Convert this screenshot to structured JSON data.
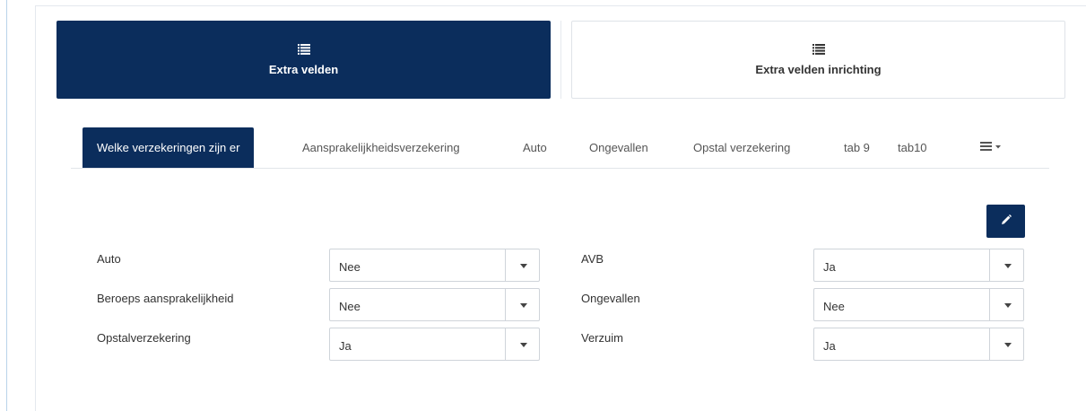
{
  "top_buttons": {
    "primary_label": "Extra velden",
    "primary_icon": "list-icon",
    "secondary_label": "Extra velden inrichting",
    "secondary_icon": "list-icon"
  },
  "tabs": [
    {
      "label": "Welke verzekeringen zijn er",
      "active": true
    },
    {
      "label": "Aansprakelijkheidsverzekering",
      "active": false
    },
    {
      "label": "Auto",
      "active": false
    },
    {
      "label": "Ongevallen",
      "active": false
    },
    {
      "label": "Opstal verzekering",
      "active": false
    },
    {
      "label": "tab 9",
      "active": false
    },
    {
      "label": "tab10",
      "active": false
    }
  ],
  "tab_menu_icon": "list-dropdown-icon",
  "edit_icon": "pencil-icon",
  "fields": {
    "left": [
      {
        "label": "Auto",
        "value": "Nee"
      },
      {
        "label": "Beroeps aansprakelijkheid",
        "value": "Nee"
      },
      {
        "label": "Opstalverzekering",
        "value": "Ja"
      }
    ],
    "right": [
      {
        "label": "AVB",
        "value": "Ja"
      },
      {
        "label": "Ongevallen",
        "value": "Nee"
      },
      {
        "label": "Verzuim",
        "value": "Ja"
      }
    ]
  },
  "colors": {
    "primary": "#0b2d5c",
    "border": "#cfd4da"
  }
}
